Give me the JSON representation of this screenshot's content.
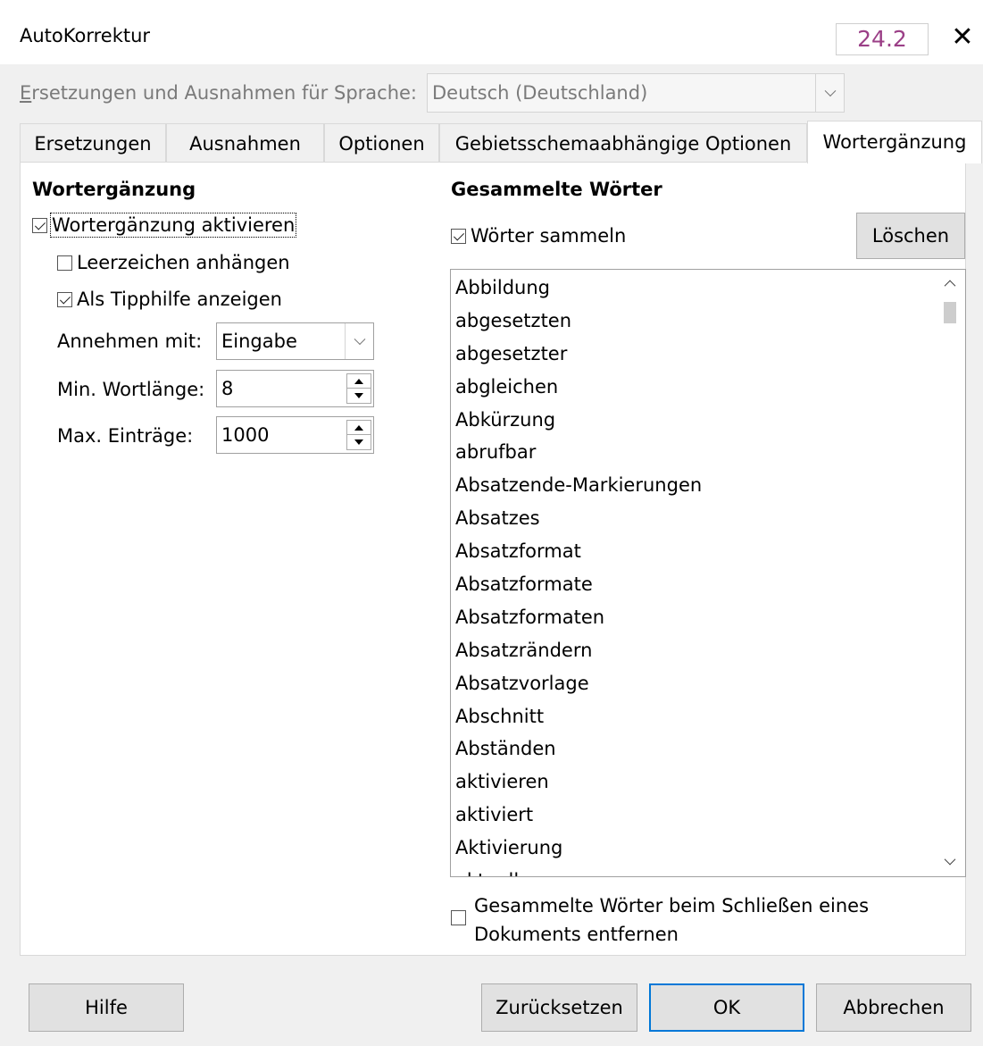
{
  "window": {
    "title": "AutoKorrektur",
    "version": "24.2",
    "close_icon": "close-icon"
  },
  "language": {
    "label": "Ersetzungen und Ausnahmen für Sprache:",
    "value": "Deutsch (Deutschland)"
  },
  "tabs": [
    {
      "label": "Ersetzungen"
    },
    {
      "label": "Ausnahmen"
    },
    {
      "label": "Optionen"
    },
    {
      "label": "Gebietsschemaabhängige Optionen"
    },
    {
      "label": "Wortergänzung",
      "active": true
    }
  ],
  "left": {
    "heading": "Wortergänzung",
    "enable_label": "Wortergänzung aktivieren",
    "enable_checked": true,
    "append_space_label": "Leerzeichen anhängen",
    "append_space_checked": false,
    "show_tip_label": "Als Tipphilfe anzeigen",
    "show_tip_checked": true,
    "accept_label": "Annehmen mit:",
    "accept_value": "Eingabe",
    "min_len_label": "Min. Wortlänge:",
    "min_len_value": "8",
    "max_entries_label": "Max. Einträge:",
    "max_entries_value": "1000"
  },
  "right": {
    "heading": "Gesammelte Wörter",
    "collect_label": "Wörter sammeln",
    "collect_checked": true,
    "delete_button": "Löschen",
    "words": [
      "Abbildung",
      "abgesetzten",
      "abgesetzter",
      "abgleichen",
      "Abkürzung",
      "abrufbar",
      "Absatzende-Markierungen",
      "Absatzes",
      "Absatzformat",
      "Absatzformate",
      "Absatzformaten",
      "Absatzrändern",
      "Absatzvorlage",
      "Abschnitt",
      "Abständen",
      "aktivieren",
      "aktiviert",
      "Aktivierung",
      "aktuellen"
    ],
    "remove_label_line1": "Gesammelte Wörter beim Schließen eines",
    "remove_label_line2": "Dokuments entfernen",
    "remove_checked": false
  },
  "footer": {
    "help": "Hilfe",
    "reset": "Zurücksetzen",
    "ok": "OK",
    "cancel": "Abbrechen"
  }
}
